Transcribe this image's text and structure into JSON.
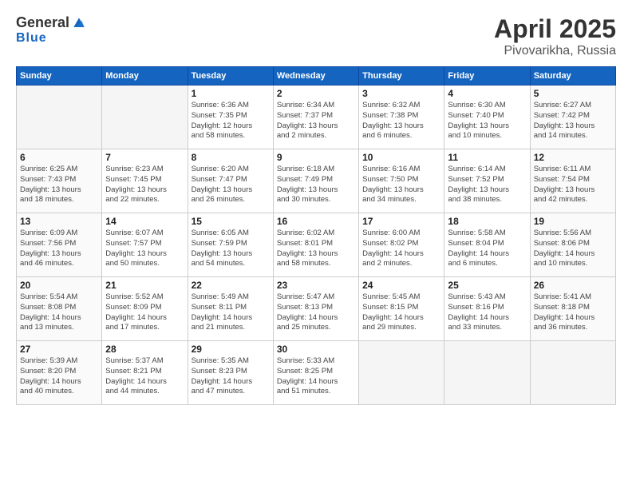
{
  "header": {
    "logo_general": "General",
    "logo_blue": "Blue",
    "month": "April 2025",
    "location": "Pivovarikha, Russia"
  },
  "days_of_week": [
    "Sunday",
    "Monday",
    "Tuesday",
    "Wednesday",
    "Thursday",
    "Friday",
    "Saturday"
  ],
  "weeks": [
    [
      {
        "day": "",
        "detail": "",
        "empty": true
      },
      {
        "day": "",
        "detail": "",
        "empty": true
      },
      {
        "day": "1",
        "detail": "Sunrise: 6:36 AM\nSunset: 7:35 PM\nDaylight: 12 hours\nand 58 minutes."
      },
      {
        "day": "2",
        "detail": "Sunrise: 6:34 AM\nSunset: 7:37 PM\nDaylight: 13 hours\nand 2 minutes."
      },
      {
        "day": "3",
        "detail": "Sunrise: 6:32 AM\nSunset: 7:38 PM\nDaylight: 13 hours\nand 6 minutes."
      },
      {
        "day": "4",
        "detail": "Sunrise: 6:30 AM\nSunset: 7:40 PM\nDaylight: 13 hours\nand 10 minutes."
      },
      {
        "day": "5",
        "detail": "Sunrise: 6:27 AM\nSunset: 7:42 PM\nDaylight: 13 hours\nand 14 minutes."
      }
    ],
    [
      {
        "day": "6",
        "detail": "Sunrise: 6:25 AM\nSunset: 7:43 PM\nDaylight: 13 hours\nand 18 minutes."
      },
      {
        "day": "7",
        "detail": "Sunrise: 6:23 AM\nSunset: 7:45 PM\nDaylight: 13 hours\nand 22 minutes."
      },
      {
        "day": "8",
        "detail": "Sunrise: 6:20 AM\nSunset: 7:47 PM\nDaylight: 13 hours\nand 26 minutes."
      },
      {
        "day": "9",
        "detail": "Sunrise: 6:18 AM\nSunset: 7:49 PM\nDaylight: 13 hours\nand 30 minutes."
      },
      {
        "day": "10",
        "detail": "Sunrise: 6:16 AM\nSunset: 7:50 PM\nDaylight: 13 hours\nand 34 minutes."
      },
      {
        "day": "11",
        "detail": "Sunrise: 6:14 AM\nSunset: 7:52 PM\nDaylight: 13 hours\nand 38 minutes."
      },
      {
        "day": "12",
        "detail": "Sunrise: 6:11 AM\nSunset: 7:54 PM\nDaylight: 13 hours\nand 42 minutes."
      }
    ],
    [
      {
        "day": "13",
        "detail": "Sunrise: 6:09 AM\nSunset: 7:56 PM\nDaylight: 13 hours\nand 46 minutes."
      },
      {
        "day": "14",
        "detail": "Sunrise: 6:07 AM\nSunset: 7:57 PM\nDaylight: 13 hours\nand 50 minutes."
      },
      {
        "day": "15",
        "detail": "Sunrise: 6:05 AM\nSunset: 7:59 PM\nDaylight: 13 hours\nand 54 minutes."
      },
      {
        "day": "16",
        "detail": "Sunrise: 6:02 AM\nSunset: 8:01 PM\nDaylight: 13 hours\nand 58 minutes."
      },
      {
        "day": "17",
        "detail": "Sunrise: 6:00 AM\nSunset: 8:02 PM\nDaylight: 14 hours\nand 2 minutes."
      },
      {
        "day": "18",
        "detail": "Sunrise: 5:58 AM\nSunset: 8:04 PM\nDaylight: 14 hours\nand 6 minutes."
      },
      {
        "day": "19",
        "detail": "Sunrise: 5:56 AM\nSunset: 8:06 PM\nDaylight: 14 hours\nand 10 minutes."
      }
    ],
    [
      {
        "day": "20",
        "detail": "Sunrise: 5:54 AM\nSunset: 8:08 PM\nDaylight: 14 hours\nand 13 minutes."
      },
      {
        "day": "21",
        "detail": "Sunrise: 5:52 AM\nSunset: 8:09 PM\nDaylight: 14 hours\nand 17 minutes."
      },
      {
        "day": "22",
        "detail": "Sunrise: 5:49 AM\nSunset: 8:11 PM\nDaylight: 14 hours\nand 21 minutes."
      },
      {
        "day": "23",
        "detail": "Sunrise: 5:47 AM\nSunset: 8:13 PM\nDaylight: 14 hours\nand 25 minutes."
      },
      {
        "day": "24",
        "detail": "Sunrise: 5:45 AM\nSunset: 8:15 PM\nDaylight: 14 hours\nand 29 minutes."
      },
      {
        "day": "25",
        "detail": "Sunrise: 5:43 AM\nSunset: 8:16 PM\nDaylight: 14 hours\nand 33 minutes."
      },
      {
        "day": "26",
        "detail": "Sunrise: 5:41 AM\nSunset: 8:18 PM\nDaylight: 14 hours\nand 36 minutes."
      }
    ],
    [
      {
        "day": "27",
        "detail": "Sunrise: 5:39 AM\nSunset: 8:20 PM\nDaylight: 14 hours\nand 40 minutes."
      },
      {
        "day": "28",
        "detail": "Sunrise: 5:37 AM\nSunset: 8:21 PM\nDaylight: 14 hours\nand 44 minutes."
      },
      {
        "day": "29",
        "detail": "Sunrise: 5:35 AM\nSunset: 8:23 PM\nDaylight: 14 hours\nand 47 minutes."
      },
      {
        "day": "30",
        "detail": "Sunrise: 5:33 AM\nSunset: 8:25 PM\nDaylight: 14 hours\nand 51 minutes."
      },
      {
        "day": "",
        "detail": "",
        "empty": true
      },
      {
        "day": "",
        "detail": "",
        "empty": true
      },
      {
        "day": "",
        "detail": "",
        "empty": true
      }
    ]
  ]
}
